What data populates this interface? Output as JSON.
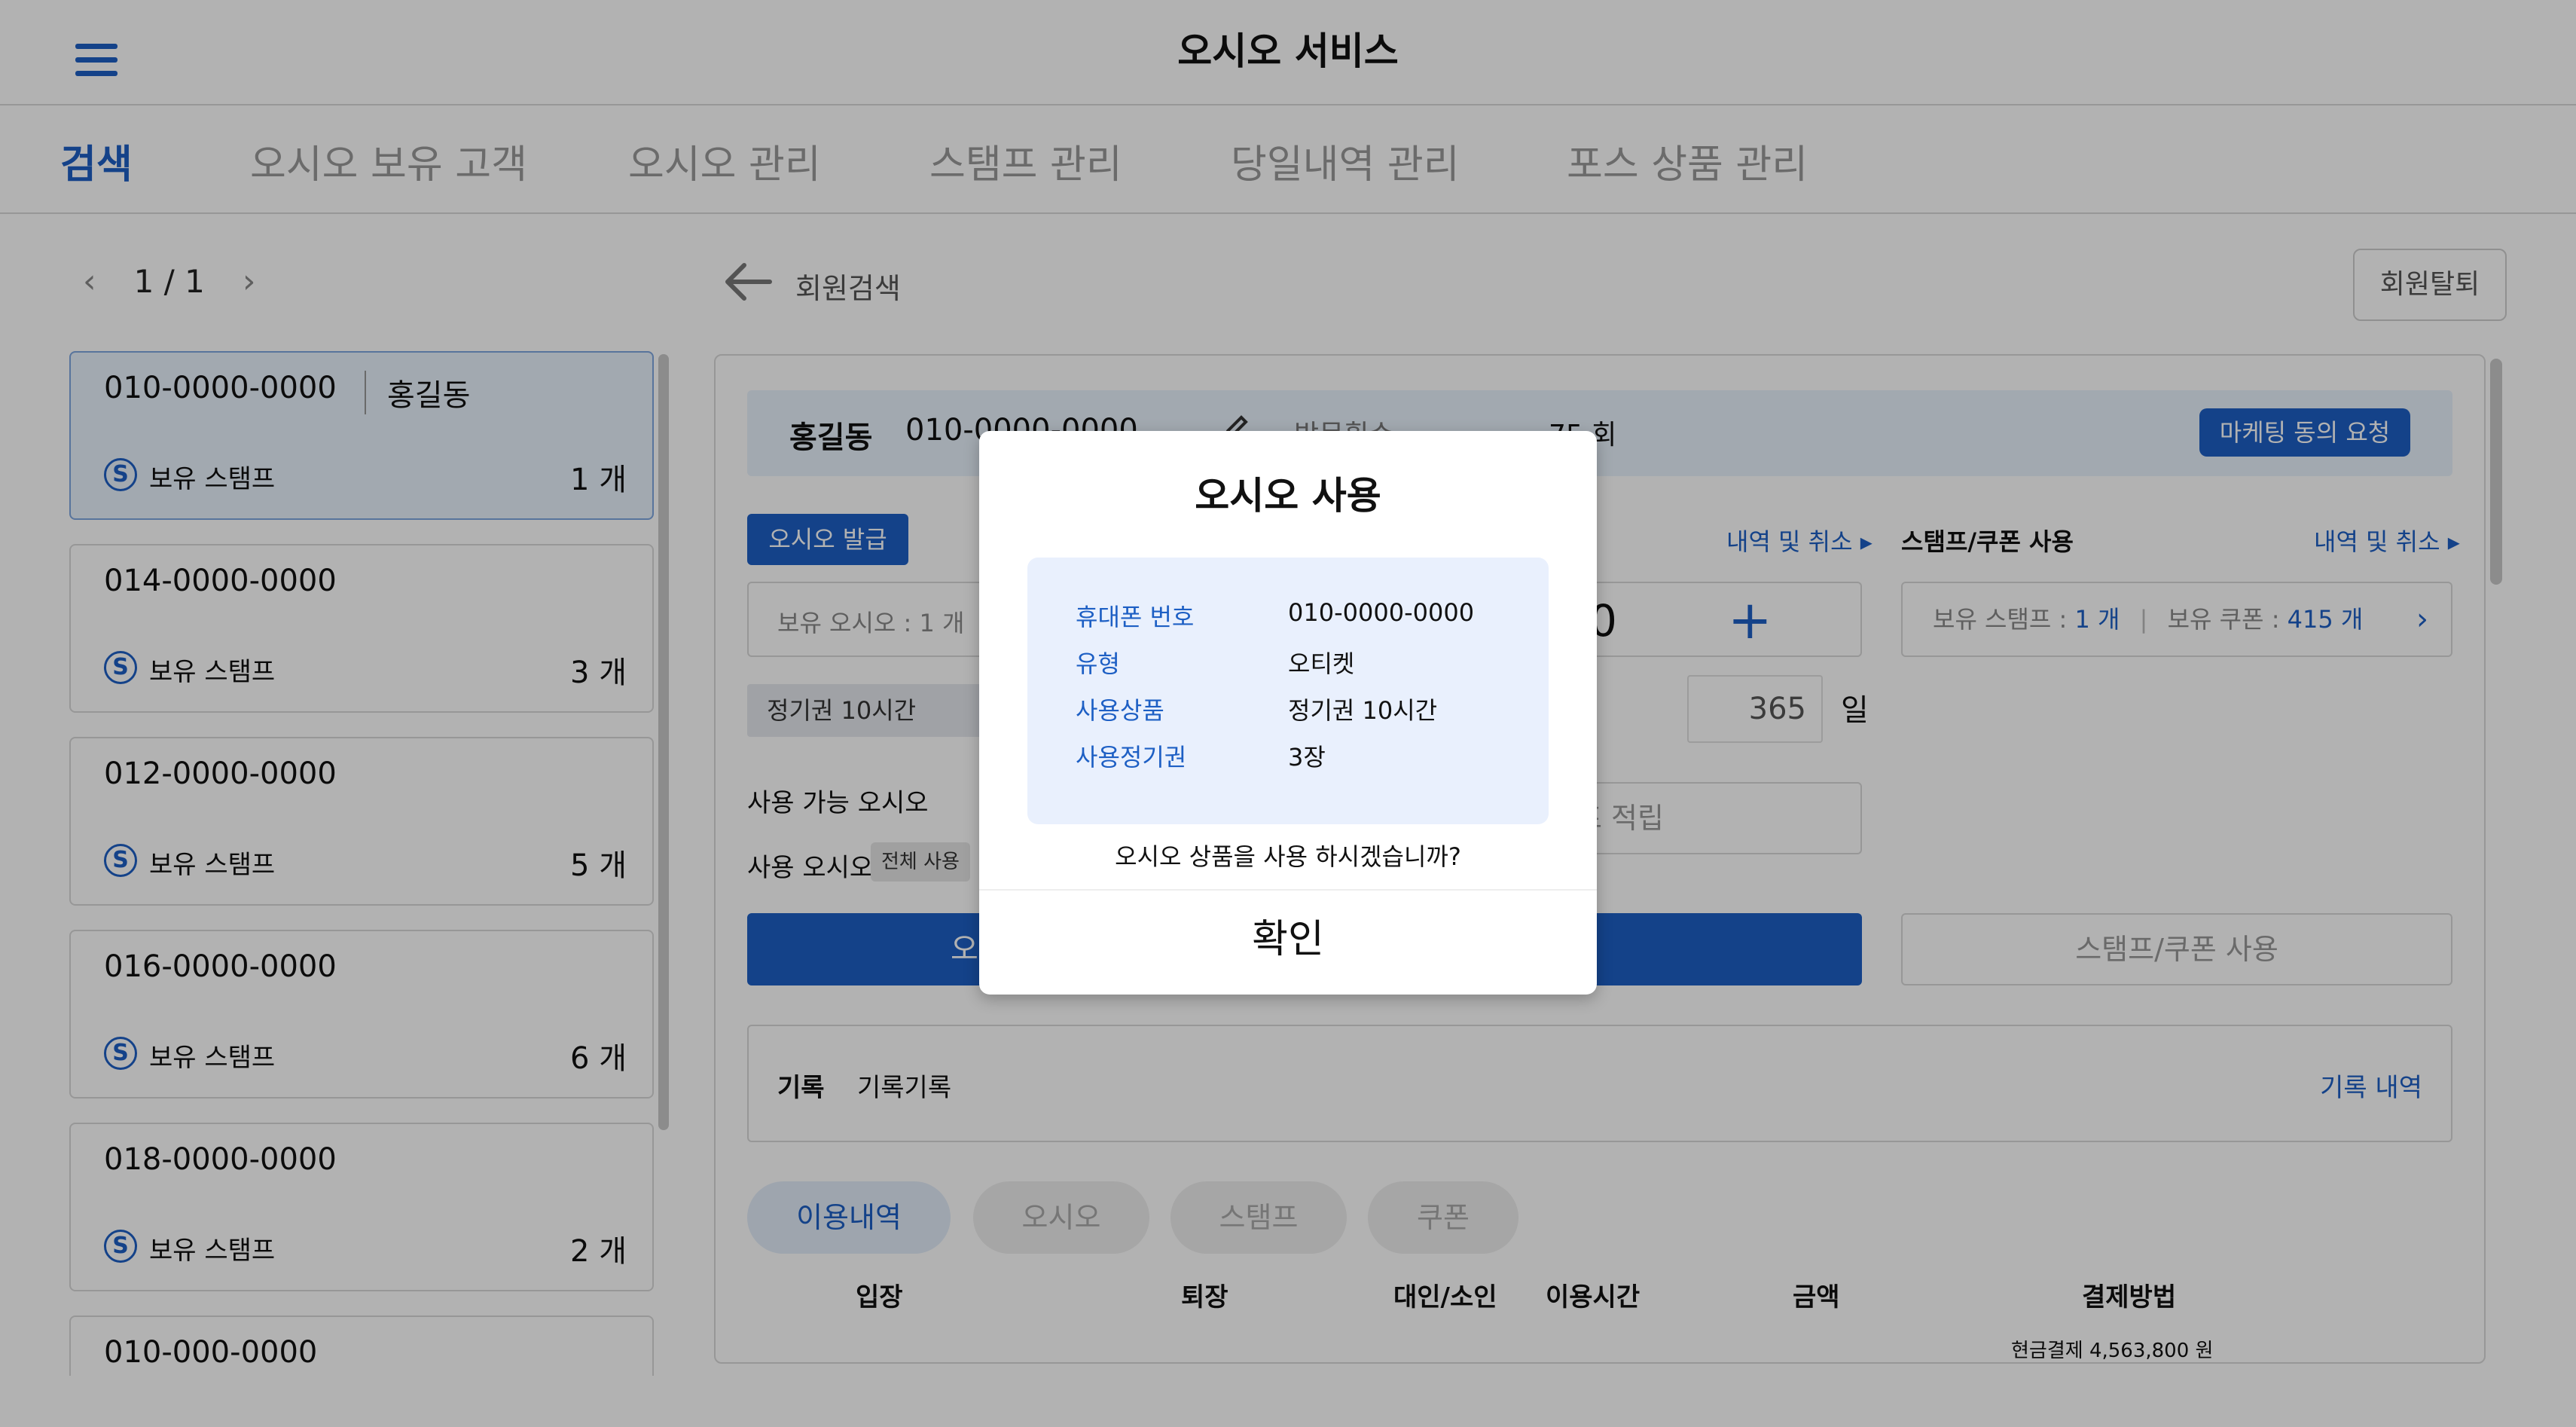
{
  "app": {
    "title": "오시오 서비스"
  },
  "tabs": [
    {
      "label": "검색",
      "active": true
    },
    {
      "label": "오시오 보유 고객"
    },
    {
      "label": "오시오 관리"
    },
    {
      "label": "스탬프 관리"
    },
    {
      "label": "당일내역 관리"
    },
    {
      "label": "포스 상품 관리"
    }
  ],
  "pager": {
    "prev": "‹",
    "text": "1 / 1",
    "next": "›"
  },
  "members": [
    {
      "phone": "010-0000-0000",
      "name": "홍길동",
      "stamp_label": "보유 스탬프",
      "count": "1 개",
      "selected": true
    },
    {
      "phone": "014-0000-0000",
      "stamp_label": "보유 스탬프",
      "count": "3 개"
    },
    {
      "phone": "012-0000-0000",
      "stamp_label": "보유 스탬프",
      "count": "5 개"
    },
    {
      "phone": "016-0000-0000",
      "stamp_label": "보유 스탬프",
      "count": "6 개"
    },
    {
      "phone": "018-0000-0000",
      "stamp_label": "보유 스탬프",
      "count": "2 개"
    },
    {
      "phone": "010-000-0000"
    }
  ],
  "stamp_glyph": "S",
  "breadcrumb": "회원검색",
  "withdraw_button": "회원탈퇴",
  "member_info": {
    "name": "홍길동",
    "phone": "010-0000-0000",
    "visit_label": "방문횟수",
    "visit_value": "75 회",
    "marketing_button": "마케팅 동의 요청"
  },
  "osio": {
    "issue_button": "오시오 발급",
    "history_link": "내역 및 취소",
    "held_label": "보유 오시오 : 1 개",
    "quantity": "0",
    "season_pass": "정기권 10시간",
    "days_value": "365",
    "days_unit": "일",
    "available_label": "사용 가능 오시오",
    "use_label": "사용 오시오",
    "all_use_button": "전체 사용",
    "use_button": "오",
    "stamp_earn": "프 적립"
  },
  "stamp_coupon": {
    "title": "스탬프/쿠폰 사용",
    "history_link": "내역 및 취소",
    "held_stamp_label": "보유 스탬프 : ",
    "held_stamp_value": "1 개",
    "held_coupon_label": "보유 쿠폰 : ",
    "held_coupon_value": "415 개",
    "use_button": "스탬프/쿠폰 사용"
  },
  "memo": {
    "label": "기록",
    "text": "기록기록",
    "history_link": "기록 내역"
  },
  "history_tabs": [
    {
      "label": "이용내역",
      "active": true
    },
    {
      "label": "오시오"
    },
    {
      "label": "스탬프"
    },
    {
      "label": "쿠폰"
    }
  ],
  "table": {
    "columns": [
      "입장",
      "퇴장",
      "대인/소인",
      "이용시간",
      "금액",
      "결제방법"
    ],
    "rows": [
      {
        "payment": "현금결제 4,563,800 원"
      }
    ]
  },
  "modal": {
    "title": "오시오 사용",
    "fields": [
      {
        "key": "휴대폰 번호",
        "value": "010-0000-0000"
      },
      {
        "key": "유형",
        "value": "오티켓"
      },
      {
        "key": "사용상품",
        "value": "정기권 10시간"
      },
      {
        "key": "사용정기권",
        "value": "3장"
      }
    ],
    "question": "오시오 상품을 사용 하시겠습니까?",
    "confirm": "확인"
  },
  "colors": {
    "accent": "#1d5fc4",
    "selected_bg": "#e9f2fc",
    "overlay": "rgba(0,0,0,0.30)"
  },
  "icons": [
    "menu-icon",
    "chevron-left-icon",
    "chevron-right-icon",
    "back-arrow-icon",
    "stamp-icon",
    "edit-icon",
    "plus-icon",
    "caret-right-icon"
  ]
}
